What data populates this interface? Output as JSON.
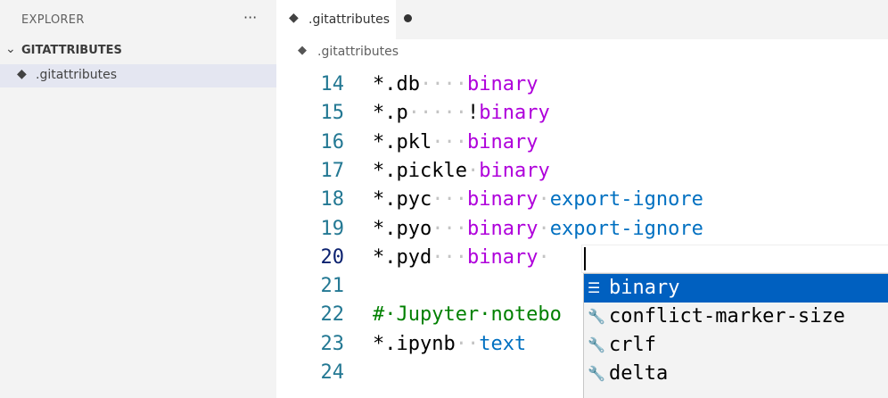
{
  "sidebar": {
    "title": "EXPLORER",
    "more_icon": "ellipsis-icon",
    "more_glyph": "···",
    "section_label": "GITATTRIBUTES",
    "section_chevron": "⌄",
    "file_icon_glyph": "◆",
    "file_name": ".gitattributes"
  },
  "tabs": [
    {
      "label": ".gitattributes",
      "icon_glyph": "◆",
      "dirty": true
    }
  ],
  "breadcrumb": {
    "icon_glyph": "◆",
    "label": ".gitattributes"
  },
  "editor": {
    "current_line": 20,
    "lines": [
      {
        "num": "14",
        "pattern": "*.db",
        "ws": "····",
        "attr1": "binary",
        "ws2": "",
        "attr2": ""
      },
      {
        "num": "15",
        "pattern": "*.p",
        "ws": "·····",
        "attr1": "!binary",
        "ws2": "",
        "attr2": ""
      },
      {
        "num": "16",
        "pattern": "*.pkl",
        "ws": "···",
        "attr1": "binary",
        "ws2": "",
        "attr2": ""
      },
      {
        "num": "17",
        "pattern": "*.pickle",
        "ws": "·",
        "attr1": "binary",
        "ws2": "",
        "attr2": ""
      },
      {
        "num": "18",
        "pattern": "*.pyc",
        "ws": "···",
        "attr1": "binary",
        "ws2": "·",
        "attr2": "export-ignore"
      },
      {
        "num": "19",
        "pattern": "*.pyo",
        "ws": "···",
        "attr1": "binary",
        "ws2": "·",
        "attr2": "export-ignore"
      },
      {
        "num": "20",
        "pattern": "*.pyd",
        "ws": "···",
        "attr1": "binary",
        "ws2": "·",
        "attr2": ""
      },
      {
        "num": "21",
        "pattern": "",
        "ws": "",
        "attr1": "",
        "ws2": "",
        "attr2": ""
      },
      {
        "num": "22",
        "comment": "#·Jupyter·notebo"
      },
      {
        "num": "23",
        "pattern": "*.ipynb",
        "ws": "··",
        "attr1": "",
        "ws2": "",
        "attr2": "text"
      },
      {
        "num": "24",
        "pattern": "",
        "ws": "",
        "attr1": "",
        "ws2": "",
        "attr2": ""
      }
    ]
  },
  "suggest": {
    "items": [
      {
        "label": "binary",
        "icon": "snippet-icon",
        "glyph": "☰",
        "selected": true
      },
      {
        "label": "conflict-marker-size",
        "icon": "wrench-icon",
        "glyph": "🔧",
        "selected": false
      },
      {
        "label": "crlf",
        "icon": "wrench-icon",
        "glyph": "🔧",
        "selected": false
      },
      {
        "label": "delta",
        "icon": "wrench-icon",
        "glyph": "🔧",
        "selected": false
      }
    ]
  },
  "colors": {
    "attribute_keyword": "#af00db",
    "attribute_value": "#0070c1",
    "comment": "#008000",
    "line_number": "#237893",
    "selection": "#0060c0"
  }
}
